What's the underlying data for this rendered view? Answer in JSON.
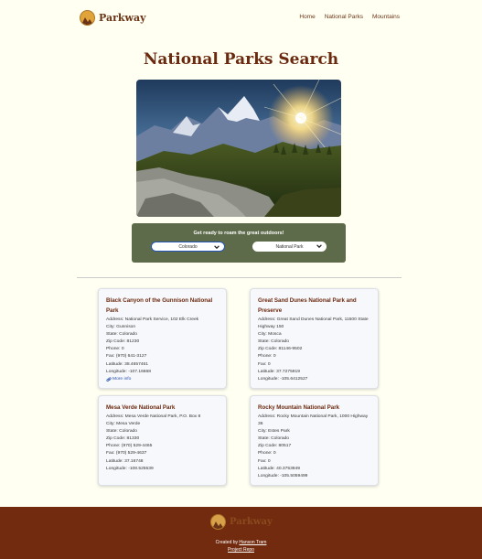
{
  "header": {
    "brand": "Parkway",
    "nav": [
      "Home",
      "National Parks",
      "Mountains"
    ]
  },
  "main": {
    "title": "National Parks Search",
    "search": {
      "prompt": "Get ready to roam the great outdoors!",
      "state_value": "Colorado",
      "type_value": "National Park"
    }
  },
  "parks": [
    {
      "name": "Black Canyon of the Gunnison National Park",
      "lines": [
        "Address: National Park Service, 102 Elk Creek",
        "City: Gunnison",
        "State: Colorado",
        "Zip Code: 81230",
        "Phone: 0",
        "Fax: (970) 641-3127",
        "Latitude: 38.4657461",
        "Longitude: -107.16668"
      ],
      "more_info": "More info"
    },
    {
      "name": "Great Sand Dunes National Park and Preserve",
      "lines": [
        "Address: Great Sand Dunes National Park, 11500 State Highway 150",
        "City: Mosca",
        "State: Colorado",
        "Zip Code: 81146-9502",
        "Phone: 0",
        "Fax: 0",
        "Latitude: 37.7275919",
        "Longitude: -105.6412527"
      ]
    },
    {
      "name": "Mesa Verde National Park",
      "lines": [
        "Address: Mesa Verde National Park, P.O. Box 8",
        "City: Mesa Verde",
        "State: Colorado",
        "Zip Code: 81330",
        "Phone: (970) 529-4465",
        "Fax: (970) 529-4637",
        "Latitude: 37.16748",
        "Longitude: -108.525539"
      ]
    },
    {
      "name": "Rocky Mountain National Park",
      "lines": [
        "Address: Rocky Mountain National Park, 1000 Highway 36",
        "City: Estes Park",
        "State: Colorado",
        "Zip Code: 80517",
        "Phone: 0",
        "Fax: 0",
        "Latitude: 40.3753949",
        "Longitude: -105.5059499"
      ]
    }
  ],
  "footer": {
    "brand": "Parkway",
    "credit_prefix": "Created by ",
    "credit_link": "Hanson Tram",
    "repo": "Project Repo"
  },
  "colors": {
    "background": "#fffff2",
    "brand_brown": "#6b2a10",
    "panel_green": "#5e6b4a",
    "footer": "#722b0f"
  },
  "icons": [
    "parkway-logo-icon",
    "chevron-down-icon",
    "link-icon"
  ]
}
